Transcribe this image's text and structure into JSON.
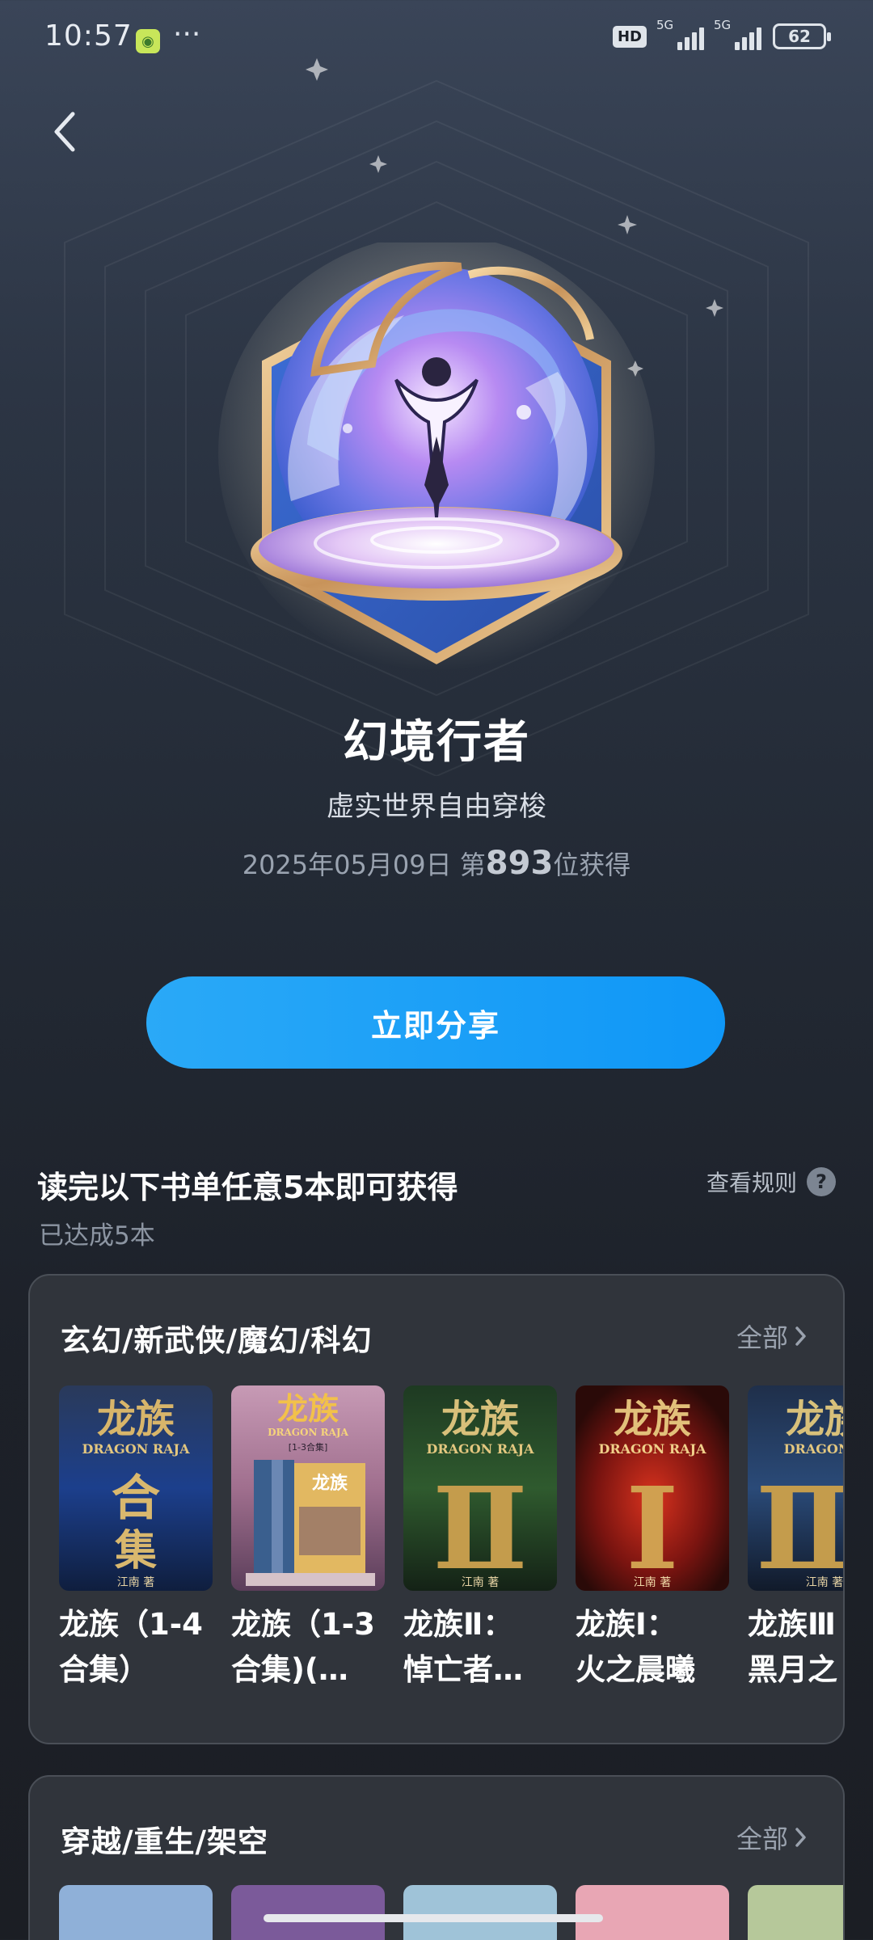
{
  "status_bar": {
    "time": "10:57",
    "more": "···",
    "hd": "HD",
    "network_1": "5G",
    "network_2": "5G",
    "battery": "62"
  },
  "badge": {
    "name": "幻境行者",
    "description": "虚实世界自由穿梭",
    "date": "2025年05月09日",
    "rank_prefix": "第",
    "rank": "893",
    "rank_suffix": "位获得"
  },
  "actions": {
    "share_label": "立即分享"
  },
  "requirement": {
    "title": "读完以下书单任意5本即可获得",
    "status": "已达成5本",
    "rules_label": "查看规则",
    "rules_icon": "?"
  },
  "lists": [
    {
      "title": "玄幻/新武侠/魔幻/科幻",
      "more_label": "全部",
      "books": [
        {
          "title": "龙族（1-4\n合集）",
          "cover": {
            "top": "龙族",
            "sub": "DRAGON RAJA",
            "big": "合\n集",
            "author": "江南 著",
            "palette": "blue"
          }
        },
        {
          "title": "龙族（1-3\n合集)(…",
          "cover": {
            "top": "龙族",
            "sub": "DRAGON RAJA",
            "big": "龙族",
            "author": "[1-3合集]",
            "palette": "sunset"
          }
        },
        {
          "title": "龙族Ⅱ：\n悼亡者…",
          "cover": {
            "top": "龙族",
            "sub": "DRAGON RAJA",
            "big": "Ⅱ",
            "author": "江南 著",
            "palette": "green"
          }
        },
        {
          "title": "龙族Ⅰ：\n火之晨曦",
          "cover": {
            "top": "龙族",
            "sub": "DRAGON RAJA",
            "big": "Ⅰ",
            "author": "江南 著",
            "palette": "red"
          }
        },
        {
          "title": "龙族Ⅲ\n黑月之",
          "cover": {
            "top": "龙族",
            "sub": "DRAGON R",
            "big": "Ⅲ",
            "author": "江南 著",
            "palette": "navy"
          }
        }
      ]
    },
    {
      "title": "穿越/重生/架空",
      "more_label": "全部",
      "covers": [
        "#8fb0d8",
        "#7b5a9a",
        "#9fc3d8",
        "#e8a6b4",
        "#b6c89a"
      ]
    }
  ],
  "colors": {
    "accent": "#1a9ff7",
    "background": "#232a35",
    "card": "#30343b"
  },
  "icons": {
    "back": "chevron-left-icon",
    "more": "chevron-right-icon",
    "rules": "question-icon"
  }
}
